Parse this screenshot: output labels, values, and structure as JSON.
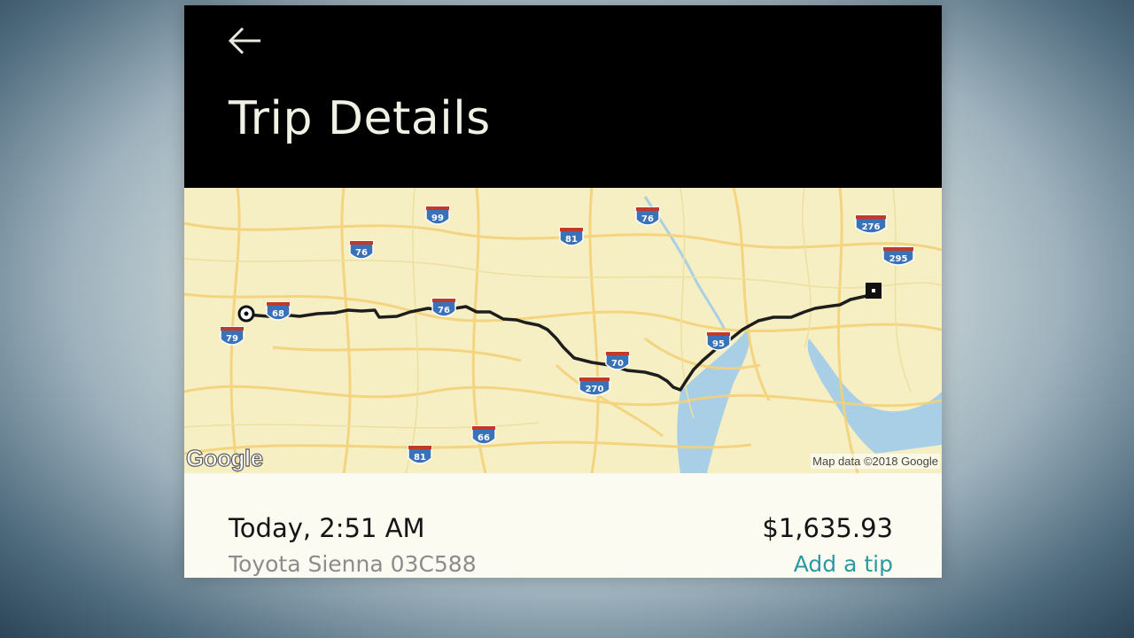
{
  "header": {
    "back_icon": "arrow-left-icon",
    "title": "Trip Details"
  },
  "map": {
    "provider_logo": "Google",
    "attribution": "Map data ©2018 Google",
    "start_marker_icon": "pickup-circle-icon",
    "end_marker_icon": "dropoff-square-icon",
    "highway_shields": [
      "99",
      "76",
      "81",
      "76",
      "276",
      "295",
      "76",
      "79",
      "68",
      "70",
      "95",
      "270",
      "66",
      "81"
    ],
    "colors": {
      "land": "#f6efc3",
      "water": "#a9cfe6",
      "road": "#f4d27a",
      "route": "#1d1d1d",
      "shield": "#3a72b8"
    }
  },
  "trip": {
    "date_time": "Today, 2:51 AM",
    "vehicle": "Toyota Sienna 03C588",
    "fare": "$1,635.93",
    "tip_link": "Add a tip"
  },
  "colors": {
    "header_bg": "#000000",
    "accent": "#2a9aa0"
  }
}
